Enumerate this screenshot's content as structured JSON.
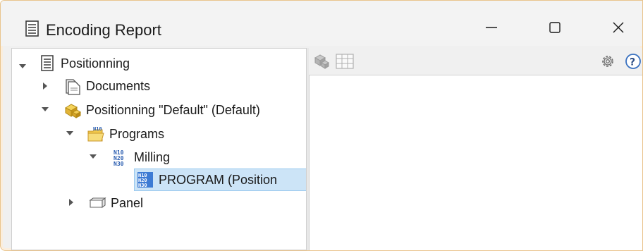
{
  "window": {
    "title": "Encoding Report",
    "controls": {
      "minimize": "minimize",
      "maximize": "maximize",
      "close": "close"
    }
  },
  "tree": {
    "root": {
      "label": "Positionning",
      "icon": "report-icon",
      "expanded": true
    },
    "documents": {
      "label": "Documents",
      "icon": "documents-icon",
      "expanded": false
    },
    "positionning_default": {
      "label": "Positionning \"Default\" (Default)",
      "icon": "part-config-icon",
      "expanded": true
    },
    "programs": {
      "label": "Programs",
      "icon": "programs-folder-icon",
      "expanded": true
    },
    "milling": {
      "label": "Milling",
      "icon": "nc-code-icon",
      "expanded": true
    },
    "program": {
      "label": "PROGRAM (Position",
      "icon": "nc-program-icon",
      "selected": true
    },
    "panel": {
      "label": "Panel",
      "icon": "panel-icon",
      "expanded": false
    }
  },
  "toolbar": {
    "left_icons": [
      "part-view-icon",
      "table-view-icon"
    ],
    "right_icons": [
      "settings-gear-icon",
      "help-icon"
    ]
  }
}
